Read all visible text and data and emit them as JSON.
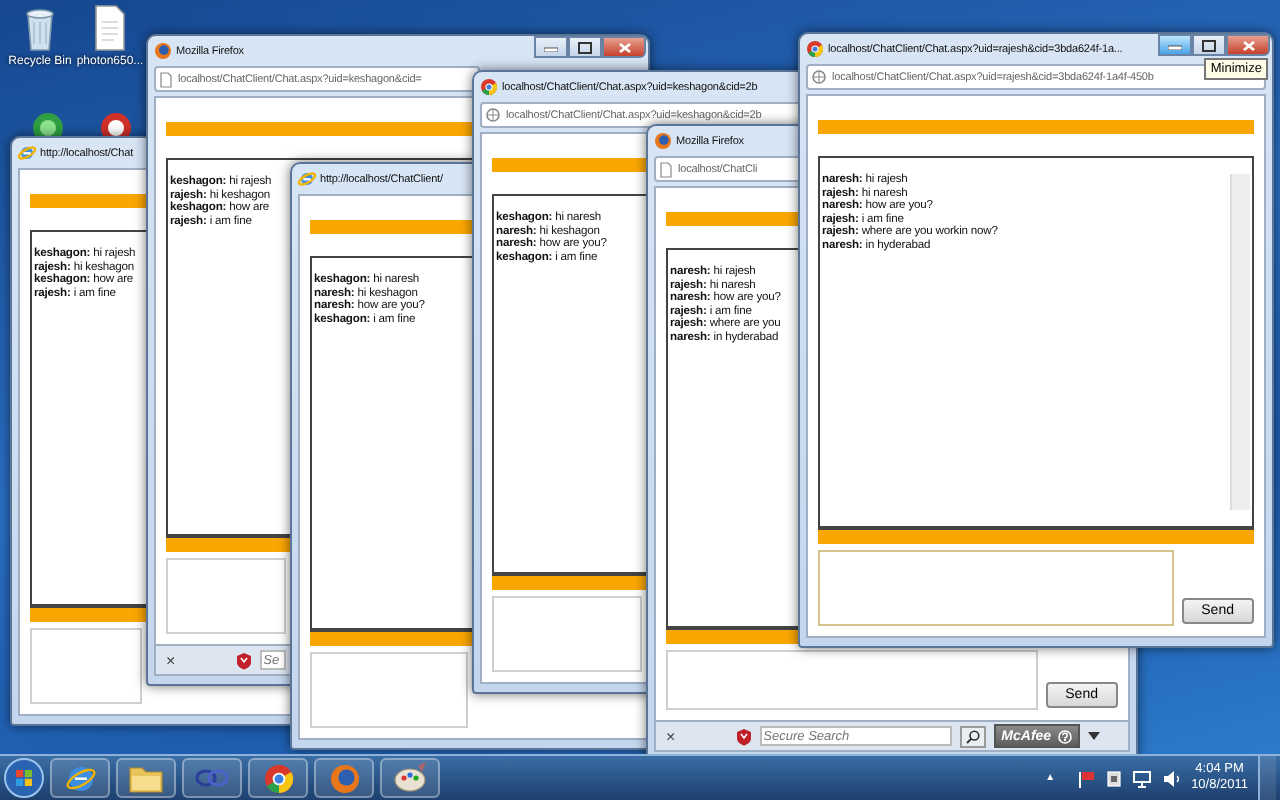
{
  "desktop_icons": [
    {
      "kind": "trash",
      "label": "Recycle Bin"
    },
    {
      "kind": "file",
      "label": "photon650..."
    },
    {
      "kind": "green"
    },
    {
      "kind": "red"
    }
  ],
  "windows": [
    {
      "kind": "ie",
      "title": "http://localhost/Chat",
      "controls": false,
      "messages": [
        "**keshagon:** hi rajesh",
        "**rajesh:** hi keshagon",
        "**keshagon:** how are",
        "**rajesh:** i am fine"
      ],
      "input": {
        "focused": false
      }
    },
    {
      "kind": "firefox",
      "title": "Mozilla Firefox",
      "controls": true,
      "address": "localhost/ChatClient/Chat.aspx?uid=keshagon&cid=",
      "messages": [
        "**keshagon:** hi rajesh",
        "**rajesh:** hi keshagon",
        "**keshagon:** how are",
        "**rajesh:** i am fine"
      ],
      "input": {
        "focused": false
      },
      "status_bar": {
        "close": "×",
        "search_placeholder": "Se"
      }
    },
    {
      "kind": "ie",
      "title": "http://localhost/ChatClient/",
      "controls": false,
      "messages": [
        "**keshagon:** hi naresh",
        "**naresh:** hi keshagon",
        "**naresh:** how are you?",
        "**keshagon:** i am fine"
      ],
      "input": {
        "focused": false
      }
    },
    {
      "kind": "chrome",
      "title": "localhost/ChatClient/Chat.aspx?uid=keshagon&cid=2b",
      "controls": false,
      "address": "localhost/ChatClient/Chat.aspx?uid=keshagon&cid=2b",
      "messages": [
        "**keshagon:** hi naresh",
        "**naresh:** hi keshagon",
        "**naresh:** how are you?",
        "**keshagon:** i am fine"
      ],
      "input": {
        "focused": false
      }
    },
    {
      "kind": "firefox",
      "title": "Mozilla Firefox",
      "controls": false,
      "address": "localhost/ChatCli",
      "messages": [
        "**naresh:** hi rajesh",
        "**rajesh:** hi naresh",
        "**naresh:** how are you?",
        "**rajesh:** i am fine",
        "**rajesh:** where are you",
        "**naresh:** in hyderabad"
      ],
      "input": {
        "focused": false
      },
      "send_button": "Send",
      "status_bar": {
        "close": "×",
        "search_placeholder": "Secure Search",
        "mcafee": "McAfee"
      }
    },
    {
      "kind": "chrome",
      "title": "localhost/ChatClient/Chat.aspx?uid=rajesh&cid=3bda624f-1a...",
      "controls": true,
      "minimize_hovered": true,
      "tooltip": "Minimize",
      "address": "localhost/ChatClient/Chat.aspx?uid=rajesh&cid=3bda624f-1a4f-450b",
      "message_scrollbar": true,
      "messages": [
        "**naresh:** hi rajesh",
        "**rajesh:** hi naresh",
        "**naresh:** how are you?",
        "**rajesh:** i am fine",
        "**rajesh:** where are you workin now?",
        "**naresh:** in hyderabad"
      ],
      "input": {
        "focused": true
      },
      "send_button": "Send"
    }
  ],
  "taskbar": {
    "apps": [
      {
        "kind": "ie"
      },
      {
        "kind": "folder"
      },
      {
        "kind": "loops"
      },
      {
        "kind": "chrome"
      },
      {
        "kind": "firefox"
      },
      {
        "kind": "paint"
      }
    ],
    "tray": {
      "caret": "▲",
      "time": "4:04 PM",
      "date": "10/8/2011"
    }
  }
}
